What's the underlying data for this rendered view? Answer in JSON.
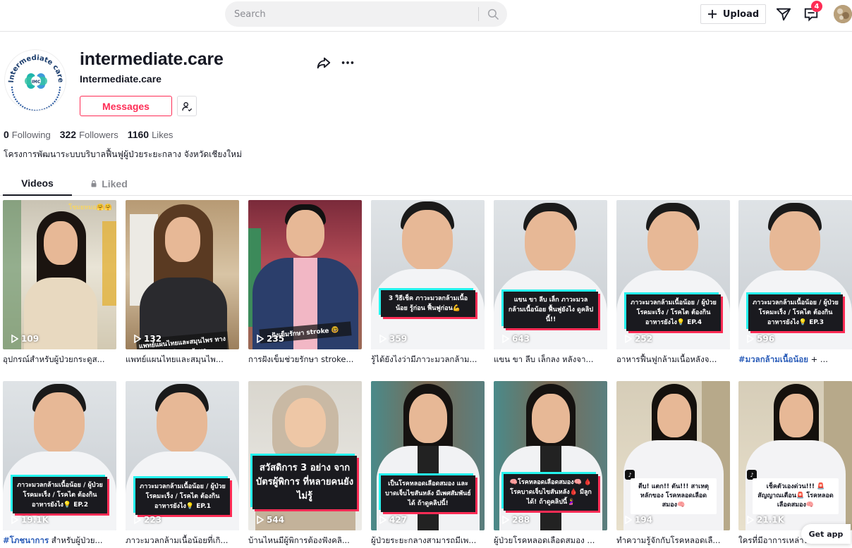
{
  "topbar": {
    "search_placeholder": "Search",
    "upload_label": "Upload",
    "inbox_badge": "4"
  },
  "profile": {
    "username": "intermediate.care",
    "nickname": "Intermediate.care",
    "avatar_text_top": "Intermediate care",
    "avatar_text_center": "IMC",
    "messages_label": "Messages",
    "stats": [
      {
        "value": "0",
        "label": "Following"
      },
      {
        "value": "322",
        "label": "Followers"
      },
      {
        "value": "1160",
        "label": "Likes"
      }
    ],
    "bio": "โครงการพัฒนาระบบบริบาลฟื้นฟูผู้ป่วยระยะกลาง จังหวัดเชียงใหม่"
  },
  "tabs": [
    {
      "label": "Videos"
    },
    {
      "label": "Liked"
    }
  ],
  "videos": [
    {
      "views": "109",
      "caption": "อุปกรณ์สำหรับผู้ป่วยกระดูส...",
      "overlay": "",
      "top_text": "โชมยหมอ🤗🤗"
    },
    {
      "views": "132",
      "caption": "แพทย์แผนไทยและสมุนไพ...",
      "overlay": "แพทย์แผนไทยและสมุนไพร ทางเลือกในการรักษา",
      "top_text": ""
    },
    {
      "views": "235",
      "caption": "การฝังเข็มช่วยรักษา stroke...",
      "overlay": "ฝังเข็มรักษา stroke 🤓",
      "top_text": ""
    },
    {
      "views": "359",
      "caption": "รู้ได้ยังไงว่ามีภาวะมวลกล้าม...",
      "overlay": "3 วิธีเช็ค ภาวะมวลกล้ามเนื้อน้อย รู้ก่อน ฟื้นฟูก่อน💪",
      "top_text": ""
    },
    {
      "views": "643",
      "caption": "แขน ขา ลีบ เล็กลง หลังจา...",
      "overlay": "แขน ขา ลีบ เล็ก ภาวะมวลกล้ามเนื้อน้อย ฟื้นฟูยังไง ดูคลิปนี้!!",
      "top_text": ""
    },
    {
      "views": "252",
      "caption": "อาหารฟื้นฟูกล้ามเนื้อหลังจ...",
      "overlay": "ภาวะมวลกล้ามเนื้อน้อย / ผู้ป่วยโรคมะเร็ง / โรคไต ต้องกินอาหารยังไง💡 EP.4",
      "top_text": ""
    },
    {
      "views": "596",
      "caption": "มวลกล้ามเนื้อน้อย + ...",
      "caption_tag": "#มวลกล้ามเนื้อน้อย",
      "caption_rest": " + ...",
      "overlay": "ภาวะมวลกล้ามเนื้อน้อย / ผู้ป่วยโรคมะเร็ง / โรคไต ต้องกินอาหารยังไง💡 EP.3",
      "top_text": ""
    },
    {
      "views": "19.1K",
      "caption": "#โภชนาการ สำหรับผู้ป่วย...",
      "caption_tag": "#โภชนาการ",
      "caption_rest": " สำหรับผู้ป่วย...",
      "overlay": "ภาวะมวลกล้ามเนื้อน้อย / ผู้ป่วยโรคมะเร็ง / โรคไต ต้องกินอาหารยังไง💡 EP.2",
      "top_text": ""
    },
    {
      "views": "223",
      "caption": "ภาวะมวลกล้ามเนื้อน้อยที่เกิ...",
      "overlay": "ภาวะมวลกล้ามเนื้อน้อย / ผู้ป่วยโรคมะเร็ง / โรคไต ต้องกินอาหารยังไง💡 EP.1",
      "top_text": ""
    },
    {
      "views": "544",
      "caption": "บ้านไหนมีผู้พิการต้องฟังคลิ...",
      "overlay": "สวัสดิการ 3 อย่าง จากบัตรผู้พิการ ที่หลายคนยังไม่รู้",
      "top_text": ""
    },
    {
      "views": "427",
      "caption": "ผู้ป่วยระยะกลางสามารถมีเพ...",
      "overlay": "เป็นโรคหลอดเลือดสมอง และบาดเจ็บไขสันหลัง มีเพศสัมพันธ์ได้ ถ้าดูคลิปนี้!",
      "top_text": ""
    },
    {
      "views": "288",
      "caption": "ผู้ป่วยโรคหลอดเลือดสมอง ...",
      "overlay": "🧠โรคหลอดเลือดสมอง🧠 🩸โรคบาดเจ็บไขสันหลัง🩸 มีลูกได้! ถ้าดูคลิปนี้🤰",
      "top_text": ""
    },
    {
      "views": "194",
      "caption": "ทำความรู้จักกับโรคหลอดเลื...",
      "overlay": "ตีบ! แตก!! ตัน!!! สาเหตุหลักของ โรคหลอดเลือดสมอง🧠",
      "top_text": ""
    },
    {
      "views": "21.1K",
      "caption": "ใครที่มีอาการเหล่านี้ระวัง...",
      "overlay": "เช็คตัวเองด่วน!!! 🚨สัญญาณเตือน🚨 โรคหลอดเลือดสมอง🧠",
      "top_text": ""
    }
  ],
  "get_app_label": "Get app",
  "colors": {
    "accent": "#fe2c55",
    "link": "#2b5db9",
    "tiktok_cyan": "#25f4ee"
  }
}
